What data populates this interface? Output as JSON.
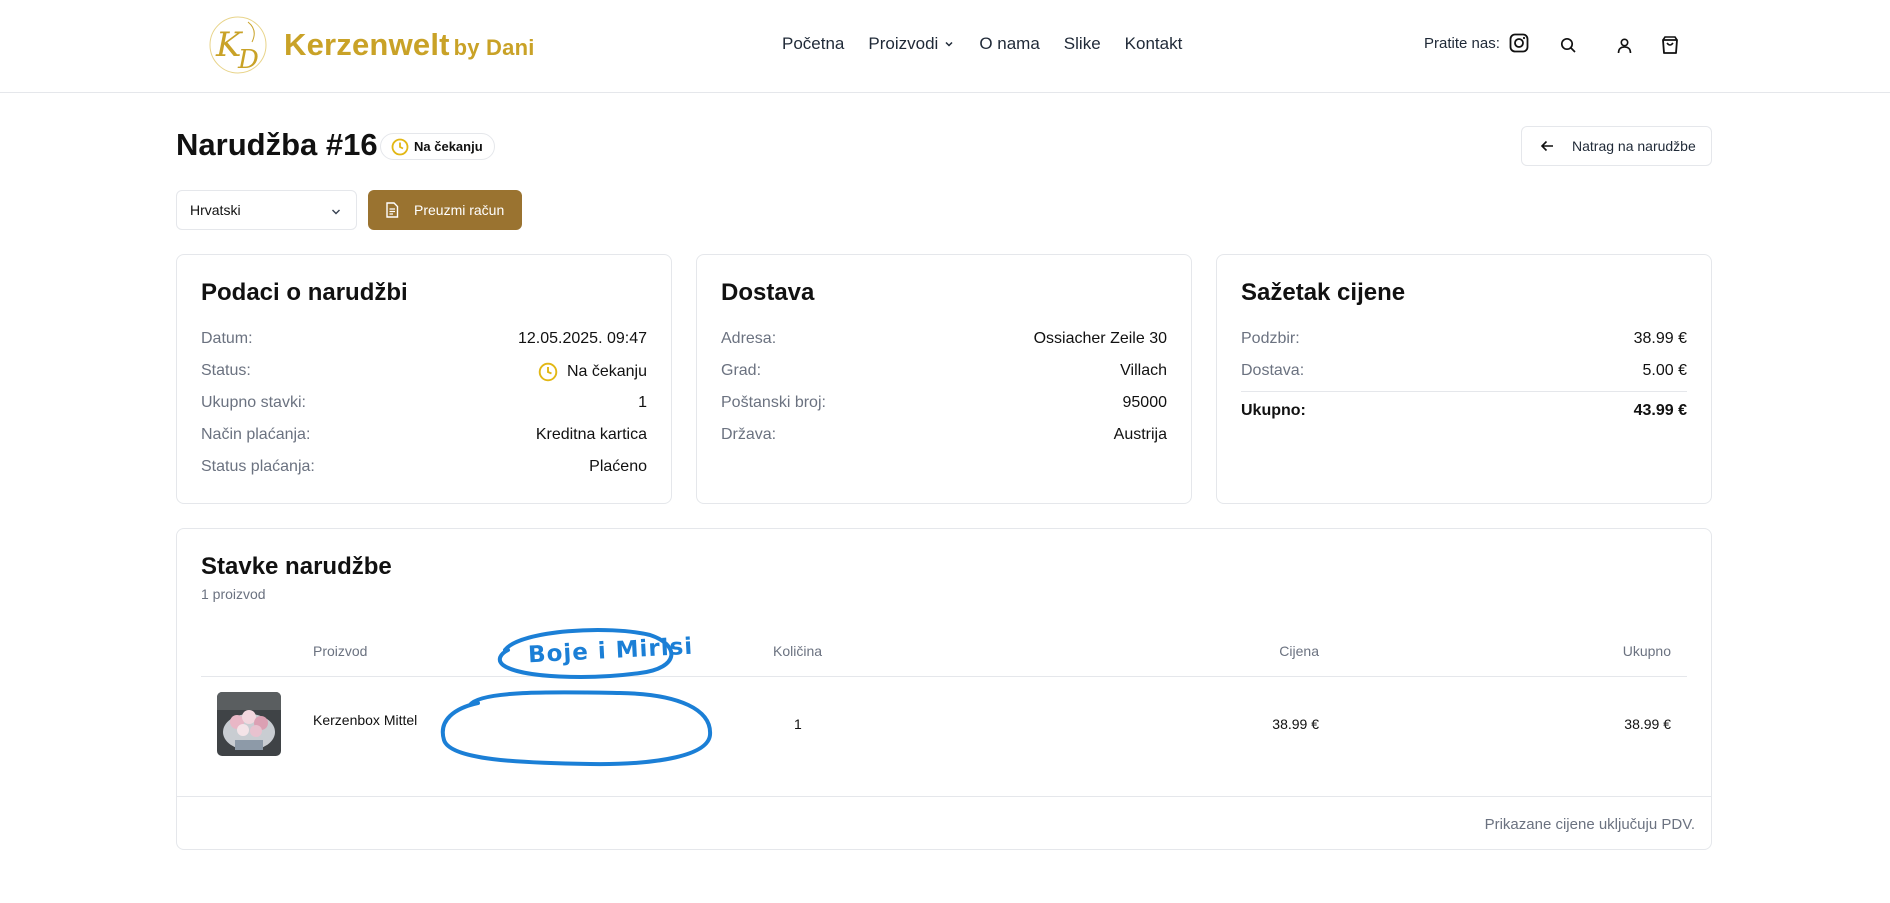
{
  "header": {
    "brand": {
      "name": "Kerzenwelt",
      "suffix": "by Dani",
      "mark_letters": "KD",
      "color": "#c9a227"
    },
    "nav": [
      {
        "label": "Početna"
      },
      {
        "label": "Proizvodi",
        "has_dropdown": true
      },
      {
        "label": "O nama"
      },
      {
        "label": "Slike"
      },
      {
        "label": "Kontakt"
      }
    ],
    "social_label": "Pratite nas:",
    "icons": [
      "instagram-icon",
      "search-icon",
      "user-icon",
      "shopping-bag-icon"
    ]
  },
  "page": {
    "title": "Narudžba #16",
    "status_badge": "Na čekanju",
    "back_button": "Natrag na narudžbe",
    "language": {
      "selected": "Hrvatski"
    },
    "download_button": "Preuzmi račun"
  },
  "order_info": {
    "title": "Podaci o narudžbi",
    "rows": [
      {
        "label": "Datum:",
        "value": "12.05.2025. 09:47"
      },
      {
        "label": "Status:",
        "value": "Na čekanju"
      },
      {
        "label": "Ukupno stavki:",
        "value": "1"
      },
      {
        "label": "Način plaćanja:",
        "value": "Kreditna kartica"
      },
      {
        "label": "Status plaćanja:",
        "value": "Plaćeno"
      }
    ]
  },
  "shipping": {
    "title": "Dostava",
    "rows": [
      {
        "label": "Adresa:",
        "value": "Ossiacher Zeile 30"
      },
      {
        "label": "Grad:",
        "value": "Villach"
      },
      {
        "label": "Poštanski broj:",
        "value": "95000"
      },
      {
        "label": "Država:",
        "value": "Austrija"
      }
    ]
  },
  "summary": {
    "title": "Sažetak cijene",
    "rows": [
      {
        "label": "Podzbir:",
        "value": "38.99 €"
      },
      {
        "label": "Dostava:",
        "value": "5.00 €"
      }
    ],
    "total": {
      "label": "Ukupno:",
      "value": "43.99 €"
    }
  },
  "items": {
    "title": "Stavke narudžbe",
    "count": "1 proizvod",
    "columns": [
      "Proizvod",
      "Količina",
      "Cijena",
      "Ukupno"
    ],
    "rows": [
      {
        "product": "Kerzenbox Mittel",
        "quantity": "1",
        "price": "38.99 €",
        "total": "38.99 €"
      }
    ],
    "vat_note": "Prikazane cijene uključuju PDV."
  },
  "annotation": {
    "text": "Boje i Mirisi",
    "color": "#1b7fd6"
  },
  "colors": {
    "accent_gold": "#c9a227",
    "button_brown": "#9a7330",
    "pending_clock": "#e2b714"
  }
}
